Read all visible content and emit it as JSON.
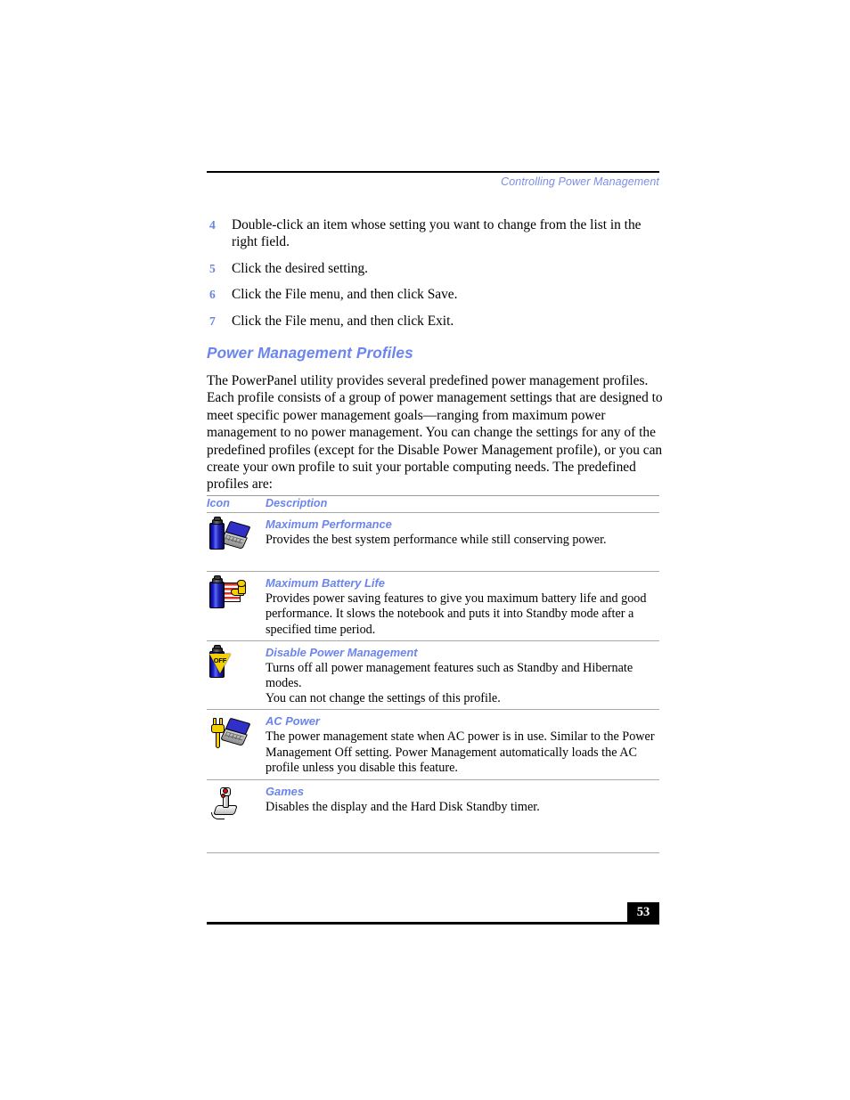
{
  "running_header": "Controlling Power Management",
  "steps": [
    {
      "num": "4",
      "text": "Double-click an item whose setting you want to change from the list in the right field."
    },
    {
      "num": "5",
      "text": "Click the desired setting."
    },
    {
      "num": "6",
      "text": "Click the File menu, and then click Save."
    },
    {
      "num": "7",
      "text": "Click the File menu, and then click Exit."
    }
  ],
  "section": {
    "heading": "Power Management Profiles",
    "intro": "The PowerPanel utility provides several predefined power management profiles. Each profile consists of a group of power management settings that are designed to meet specific power management goals—ranging from maximum power management to no power management. You can change the settings for any of the predefined profiles (except for the Disable Power Management profile), or you can create your own profile to suit your portable computing needs. The predefined profiles are:"
  },
  "table": {
    "columns": [
      "Icon",
      "Description"
    ],
    "rows": [
      {
        "icon": "battery-notebook-icon",
        "name": "Maximum Performance",
        "desc": "Provides the best system performance while still conserving power.",
        "desc2": ""
      },
      {
        "icon": "battery-muscle-arm-icon",
        "name": "Maximum Battery Life",
        "desc": "Provides power saving features to give you maximum battery life and good performance. It slows the notebook and puts it into Standby mode after a specified time period.",
        "desc2": ""
      },
      {
        "icon": "battery-off-icon",
        "name": "Disable Power Management",
        "desc": "Turns off all power management features such as Standby and Hibernate modes.",
        "desc2": "You can not change the settings of this profile."
      },
      {
        "icon": "ac-plug-notebook-icon",
        "name": "AC Power",
        "desc": "The power management state when AC power is in use. Similar to the Power Management Off setting. Power Management automatically loads the AC profile unless you disable this feature.",
        "desc2": ""
      },
      {
        "icon": "joystick-icon",
        "name": "Games",
        "desc": "Disables the display and the Hard Disk Standby timer.",
        "desc2": ""
      }
    ]
  },
  "icons": {
    "off_label": "OFF"
  },
  "footer": {
    "page_number": "53"
  },
  "colors": {
    "heading_blue": "#6b84ee",
    "header_blue": "#7b8ee8",
    "rule_black": "#000000",
    "rule_gray": "#9a9a9a"
  }
}
